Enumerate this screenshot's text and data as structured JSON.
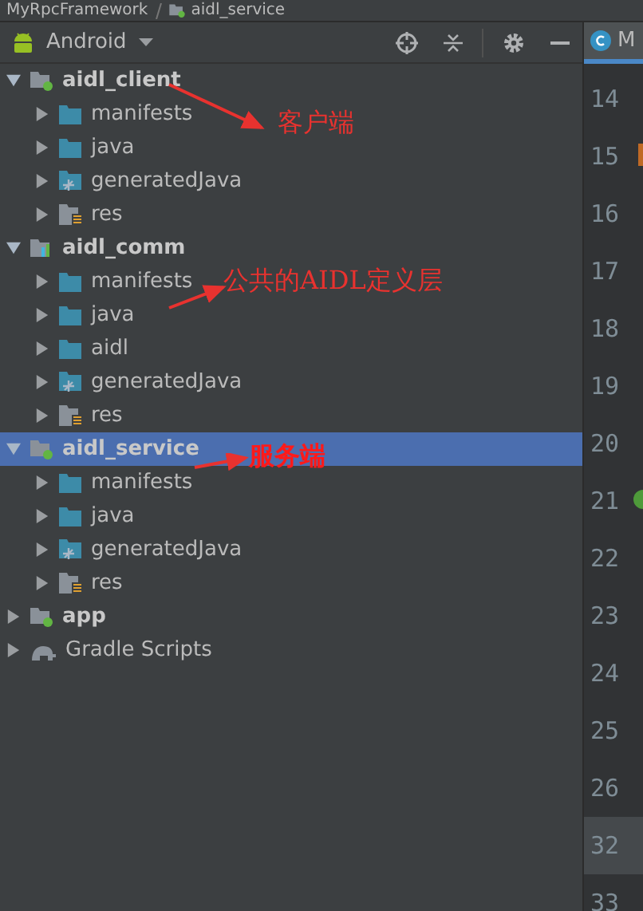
{
  "breadcrumb": [
    "MyRpcFramework",
    "aidl_service"
  ],
  "toolbar": {
    "view": "Android"
  },
  "editor_tab": {
    "label": "M"
  },
  "tree": [
    {
      "label": "aidl_client",
      "kind": "module",
      "expanded": true,
      "selected": false,
      "children": [
        {
          "label": "manifests",
          "kind": "folder",
          "expanded": false,
          "selected": false
        },
        {
          "label": "java",
          "kind": "folder",
          "expanded": false,
          "selected": false
        },
        {
          "label": "generatedJava",
          "kind": "generated",
          "expanded": false,
          "selected": false
        },
        {
          "label": "res",
          "kind": "res",
          "expanded": false,
          "selected": false
        }
      ]
    },
    {
      "label": "aidl_comm",
      "kind": "library",
      "expanded": true,
      "selected": false,
      "children": [
        {
          "label": "manifests",
          "kind": "folder",
          "expanded": false,
          "selected": false
        },
        {
          "label": "java",
          "kind": "folder",
          "expanded": false,
          "selected": false
        },
        {
          "label": "aidl",
          "kind": "folder",
          "expanded": false,
          "selected": false
        },
        {
          "label": "generatedJava",
          "kind": "generated",
          "expanded": false,
          "selected": false
        },
        {
          "label": "res",
          "kind": "res",
          "expanded": false,
          "selected": false
        }
      ]
    },
    {
      "label": "aidl_service",
      "kind": "module",
      "expanded": true,
      "selected": true,
      "children": [
        {
          "label": "manifests",
          "kind": "folder",
          "expanded": false,
          "selected": false
        },
        {
          "label": "java",
          "kind": "folder",
          "expanded": false,
          "selected": false
        },
        {
          "label": "generatedJava",
          "kind": "generated",
          "expanded": false,
          "selected": false
        },
        {
          "label": "res",
          "kind": "res",
          "expanded": false,
          "selected": false
        }
      ]
    },
    {
      "label": "app",
      "kind": "module",
      "expanded": false,
      "selected": false
    },
    {
      "label": "Gradle Scripts",
      "kind": "gradle",
      "expanded": false,
      "selected": false
    }
  ],
  "line_numbers": [
    {
      "number": "14",
      "highlighted": false,
      "kind": "plain"
    },
    {
      "number": "15",
      "highlighted": false,
      "kind": "changed"
    },
    {
      "number": "16",
      "highlighted": false,
      "kind": "plain"
    },
    {
      "number": "17",
      "highlighted": false,
      "kind": "plain"
    },
    {
      "number": "18",
      "highlighted": false,
      "kind": "plain"
    },
    {
      "number": "19",
      "highlighted": false,
      "kind": "plain"
    },
    {
      "number": "20",
      "highlighted": false,
      "kind": "plain"
    },
    {
      "number": "21",
      "highlighted": false,
      "kind": "run"
    },
    {
      "number": "22",
      "highlighted": false,
      "kind": "plain"
    },
    {
      "number": "23",
      "highlighted": false,
      "kind": "plain"
    },
    {
      "number": "24",
      "highlighted": false,
      "kind": "plain"
    },
    {
      "number": "25",
      "highlighted": false,
      "kind": "plain"
    },
    {
      "number": "26",
      "highlighted": false,
      "kind": "plain"
    },
    {
      "number": "32",
      "highlighted": true,
      "kind": "plain"
    },
    {
      "number": "33",
      "highlighted": false,
      "kind": "plain"
    }
  ],
  "annotations": [
    {
      "text": "客户端"
    },
    {
      "text": "公共的AIDL定义层"
    },
    {
      "text": "服务端"
    }
  ]
}
